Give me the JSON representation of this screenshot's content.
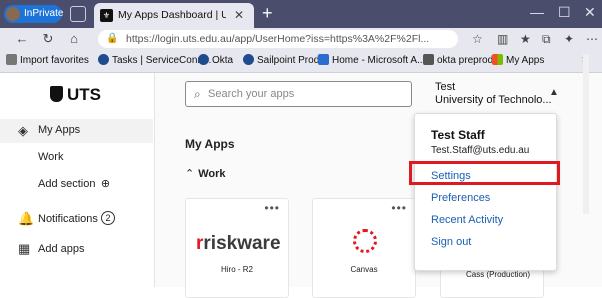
{
  "browser": {
    "profile_label": "InPrivate",
    "tab_title": "My Apps Dashboard | University of Technology Sydney",
    "url": "https://login.uts.edu.au/app/UserHome?iss=https%3A%2F%2Fl...",
    "bookmarks": [
      "Import favorites",
      "Tasks | ServiceConn...",
      "Okta",
      "Sailpoint Prod",
      "Home - Microsoft A...",
      "okta preprod",
      "My Apps"
    ]
  },
  "sidebar": {
    "logo": "UTS",
    "items": [
      {
        "label": "My Apps"
      },
      {
        "label": "Work"
      },
      {
        "label": "Add section"
      },
      {
        "label": "Notifications",
        "badge": "2"
      },
      {
        "label": "Add apps"
      }
    ]
  },
  "header": {
    "search_placeholder": "Search your apps",
    "user_name": "Test",
    "user_org": "University of Technolo..."
  },
  "main": {
    "title": "My Apps",
    "section": "Work",
    "apps": [
      {
        "label": "Hiro - R2",
        "logo": "riskware"
      },
      {
        "label": "Canvas"
      },
      {
        "label": "Cass (Production)"
      }
    ]
  },
  "dropdown": {
    "name": "Test Staff",
    "email": "Test.Staff@uts.edu.au",
    "items": [
      "Settings",
      "Preferences",
      "Recent Activity",
      "Sign out"
    ]
  },
  "colors": {
    "highlight": "#e0191f",
    "link": "#1a5fb4",
    "brand": "#111111"
  }
}
